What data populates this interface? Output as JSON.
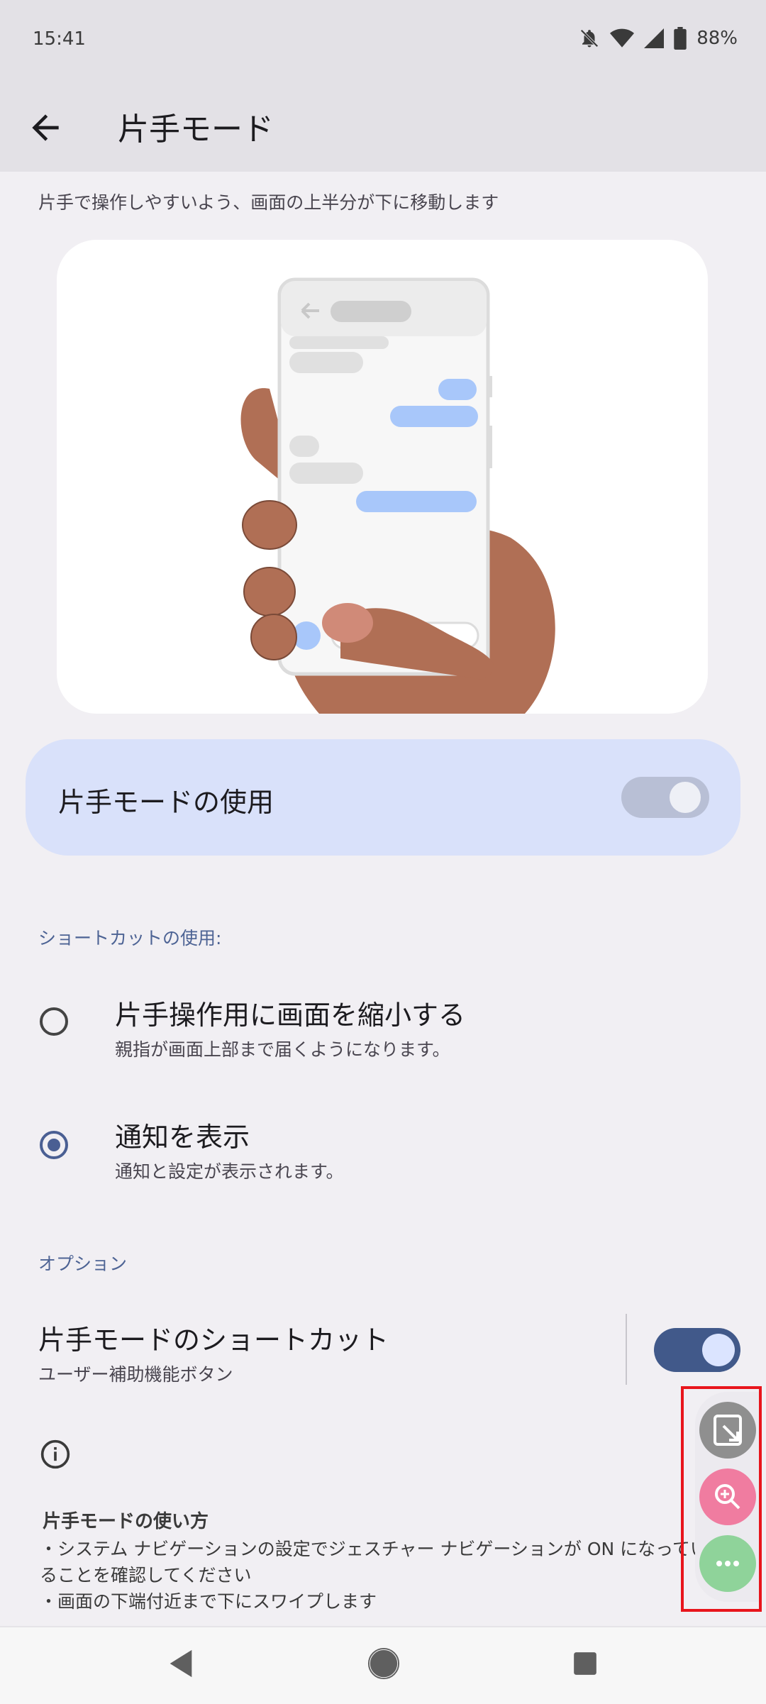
{
  "status_bar": {
    "time": "15:41",
    "battery": "88%",
    "icons": [
      "bell-off-icon",
      "wifi-icon",
      "signal-icon",
      "battery-icon"
    ]
  },
  "app_bar": {
    "title": "片手モード",
    "back_icon": "arrow-left-icon"
  },
  "subtitle": "片手で操作しやすいよう、画面の上半分が下に移動します",
  "main_toggle": {
    "label": "片手モードの使用",
    "on": false
  },
  "shortcut_section": {
    "label": "ショートカットの使用:",
    "options": [
      {
        "title": "片手操作用に画面を縮小する",
        "subtitle": "親指が画面上部まで届くようになります。",
        "selected": false
      },
      {
        "title": "通知を表示",
        "subtitle": "通知と設定が表示されます。",
        "selected": true
      }
    ]
  },
  "options_section": {
    "label": "オプション",
    "shortcut": {
      "title": "片手モードのショートカット",
      "subtitle": "ユーザー補助機能ボタン",
      "on": true
    }
  },
  "howto": {
    "title": "片手モードの使い方",
    "lines": [
      "・システム ナビゲーションの設定でジェスチャー ナビゲーションが ON になってい",
      "ることを確認してください",
      "・画面の下端付近まで下にスワイプします"
    ]
  },
  "floating_menu": {
    "buttons": [
      "one-handed-icon",
      "magnify-icon",
      "more-icon"
    ],
    "colors": [
      "#8f8f8f",
      "#f07ca0",
      "#8fd39a"
    ],
    "highlight_color": "#e8151c"
  },
  "nav_bar": {
    "buttons": [
      "back-triangle-icon",
      "home-circle-icon",
      "recents-square-icon"
    ]
  },
  "colors": {
    "accent": "#41598a",
    "card": "#d9e1fa",
    "background": "#f1eff3"
  }
}
